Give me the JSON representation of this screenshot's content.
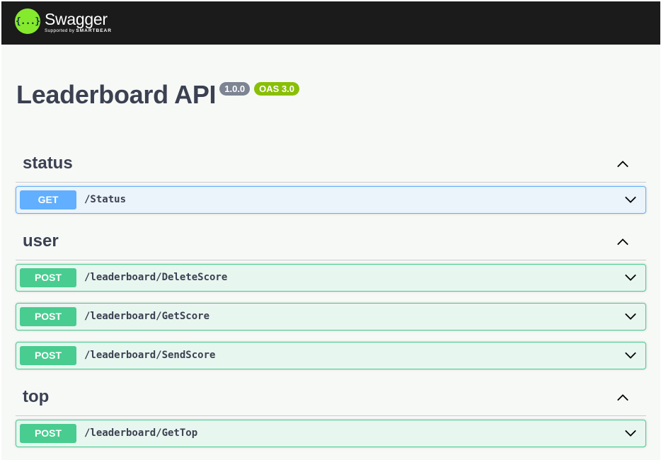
{
  "header": {
    "logo_glyph": "{...}",
    "logo_name": "Swagger",
    "logo_sub_prefix": "Supported by",
    "logo_sub_brand": "SMARTBEAR",
    "colors": {
      "bar": "#1b1b1b",
      "logo": "#85ea2d"
    }
  },
  "info": {
    "title": "Leaderboard API",
    "version": "1.0.0",
    "oas": "OAS 3.0"
  },
  "sections": [
    {
      "name": "status",
      "operations": [
        {
          "method": "GET",
          "path": "/Status"
        }
      ]
    },
    {
      "name": "user",
      "operations": [
        {
          "method": "POST",
          "path": "/leaderboard/DeleteScore"
        },
        {
          "method": "POST",
          "path": "/leaderboard/GetScore"
        },
        {
          "method": "POST",
          "path": "/leaderboard/SendScore"
        }
      ]
    },
    {
      "name": "top",
      "operations": [
        {
          "method": "POST",
          "path": "/leaderboard/GetTop"
        }
      ]
    }
  ],
  "icons": {
    "expanded": "chevron-up-icon",
    "collapsed": "chevron-down-icon"
  },
  "colors": {
    "get": "#61affe",
    "post": "#49cc90",
    "text": "#3b4151"
  }
}
